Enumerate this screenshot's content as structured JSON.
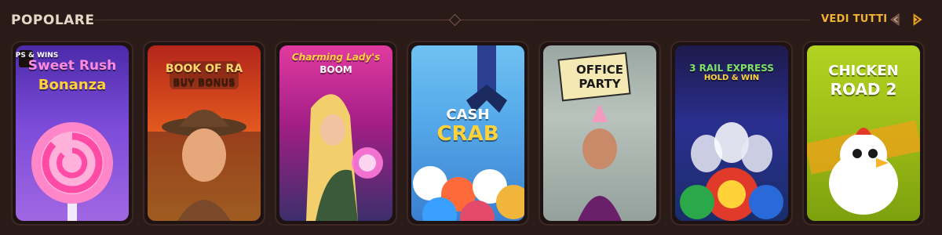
{
  "section": {
    "title": "POPOLARE",
    "see_all_label": "VEDI TUTTI",
    "prev_icon": "chevron-left-icon",
    "next_icon": "chevron-right-icon",
    "accent_color": "#f2b233"
  },
  "games": [
    {
      "id": "sweet-rush-bonanza",
      "logo_line1": "Sweet Rush",
      "logo_line2": "Bonanza",
      "badge": "DROPS & WINS"
    },
    {
      "id": "book-of-ra",
      "logo_line1": "BOOK OF RA",
      "logo_line2": "BUY BONUS"
    },
    {
      "id": "charming-ladys-boom",
      "logo_line1": "Charming Lady's",
      "logo_line2": "BOOM"
    },
    {
      "id": "cash-crab",
      "logo_line1": "CASH",
      "logo_line2": "CRAB"
    },
    {
      "id": "office-party",
      "logo_line1": "OFFICE",
      "logo_line2": "PARTY"
    },
    {
      "id": "3-rail-express",
      "logo_line1": "3 RAIL EXPRESS",
      "logo_line2": "HOLD & WIN"
    },
    {
      "id": "chicken-road-2",
      "logo_line1": "CHICKEN",
      "logo_line2": "ROAD 2"
    }
  ]
}
